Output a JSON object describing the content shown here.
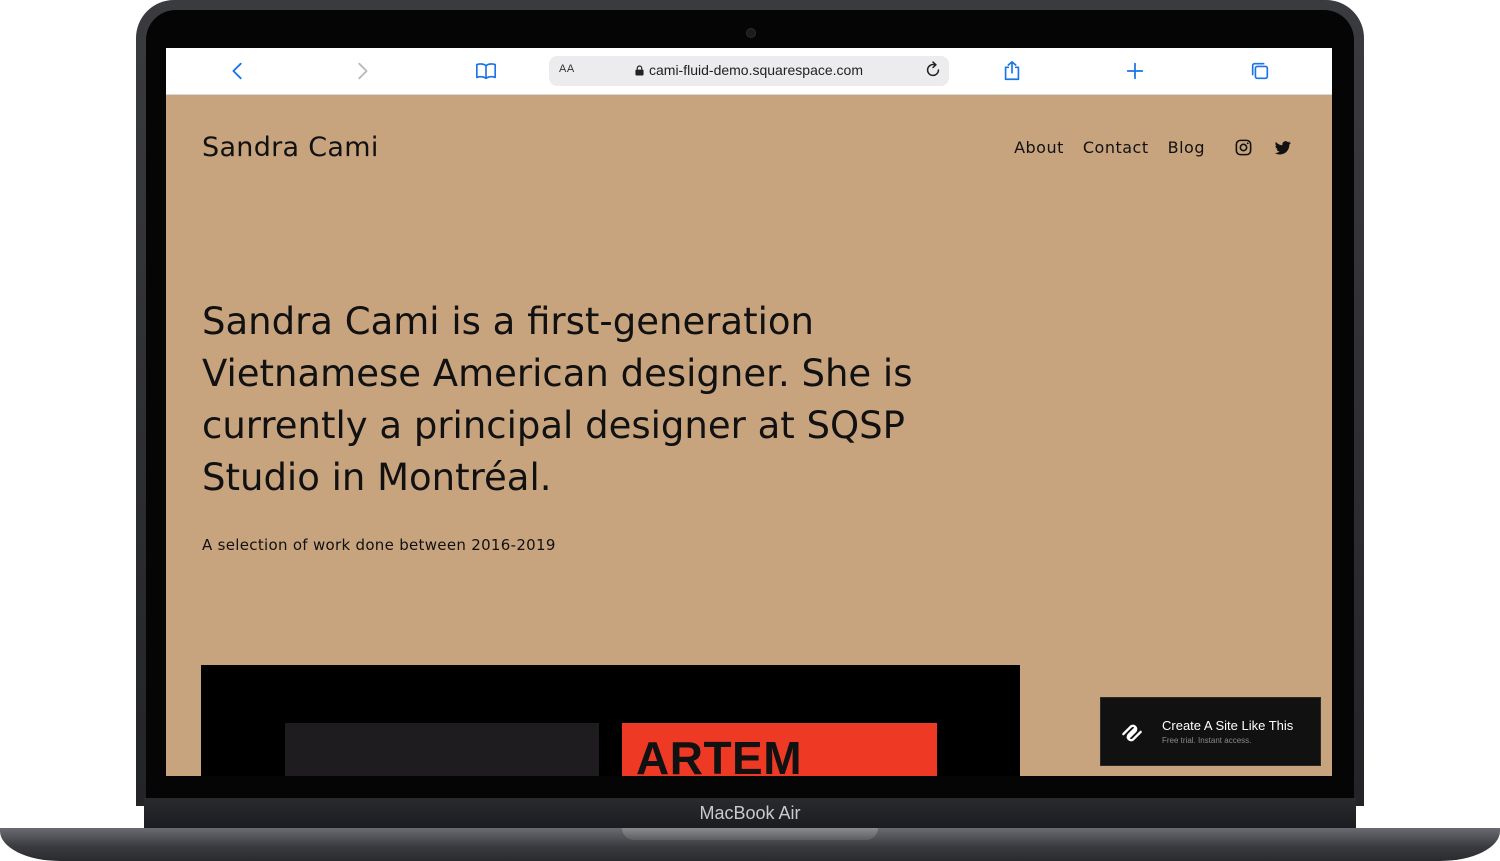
{
  "device": {
    "model_label": "MacBook Air"
  },
  "browser": {
    "text_size_label": "AA",
    "url": "cami-fluid-demo.squarespace.com",
    "icons": [
      "back-icon",
      "forward-icon",
      "bookmarks-icon",
      "lock-icon",
      "reload-icon",
      "share-icon",
      "new-tab-icon",
      "tabs-icon"
    ]
  },
  "site": {
    "title": "Sandra Cami",
    "nav": [
      {
        "label": "About"
      },
      {
        "label": "Contact"
      },
      {
        "label": "Blog"
      }
    ],
    "social_icons": [
      "instagram-icon",
      "twitter-icon"
    ],
    "headline": "Sandra Cami is a first-generation Vietnamese American designer. She is currently a principal designer at SQSP Studio in Montréal.",
    "subline": "A selection of work done between 2016-2019",
    "gallery": {
      "second_thumb_text": "ARTEM"
    }
  },
  "badge": {
    "title": "Create A Site Like This",
    "subtitle": "Free trial. Instant access."
  },
  "colors": {
    "page_background": "#c8a47e",
    "ios_blue": "#1a73e8",
    "gallery_red": "#ee3a24"
  }
}
